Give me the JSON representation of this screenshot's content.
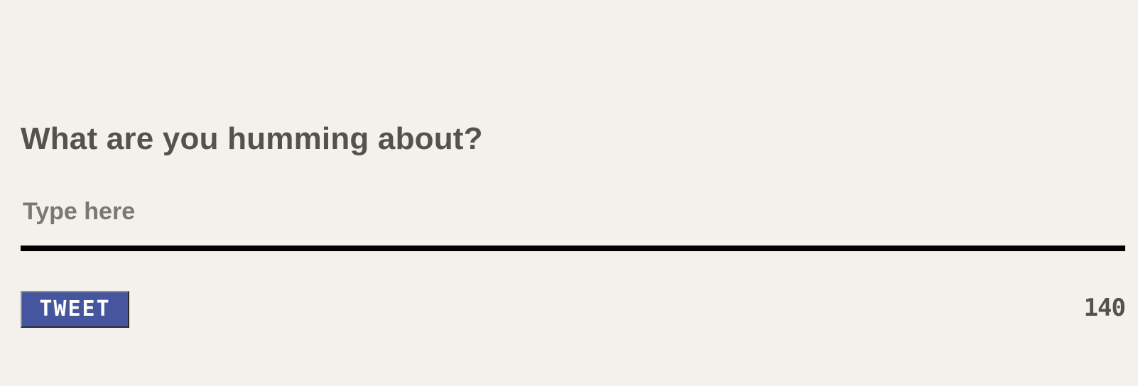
{
  "composer": {
    "heading": "What are you humming about?",
    "input": {
      "value": "",
      "placeholder": "Type here"
    },
    "tweet_button_label": "TWEET",
    "char_counter": "140"
  },
  "colors": {
    "background": "#f4f1ec",
    "heading_text": "#55524d",
    "placeholder_text": "#7b7874",
    "input_underline": "#000000",
    "button_background": "#46569e",
    "button_text": "#ffffff"
  }
}
